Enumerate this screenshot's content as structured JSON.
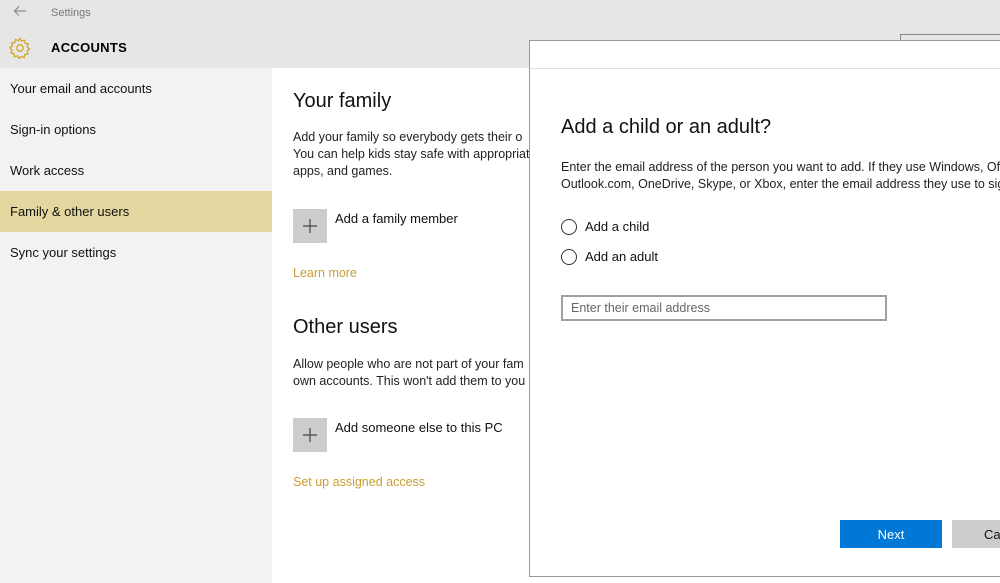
{
  "window": {
    "app_title": "Settings",
    "section_title": "ACCOUNTS",
    "back_icon": "back-arrow-icon",
    "section_icon": "gear-icon",
    "accent_color": "#c7a033"
  },
  "sidebar": {
    "items": [
      {
        "label": "Your email and accounts",
        "selected": false
      },
      {
        "label": "Sign-in options",
        "selected": false
      },
      {
        "label": "Work access",
        "selected": false
      },
      {
        "label": "Family & other users",
        "selected": true
      },
      {
        "label": "Sync your settings",
        "selected": false
      }
    ],
    "selected_color": "#e3d69e"
  },
  "main": {
    "family": {
      "heading": "Your family",
      "description_line1": "Add your family so everybody gets their o",
      "description_line2": "You can help kids stay safe with appropriat",
      "description_line3": "apps, and games.",
      "add_label": "Add a family member",
      "learn_more": "Learn more"
    },
    "other_users": {
      "heading": "Other users",
      "description_line1": "Allow people who are not part of your fam",
      "description_line2": "own accounts. This won't add them to you",
      "add_label": "Add someone else to this PC",
      "assigned_access": "Set up assigned access"
    }
  },
  "dialog": {
    "title": "Add a child or an adult?",
    "description_line1": "Enter the email address of the person you want to add. If they use Windows, Of",
    "description_line2": "Outlook.com, OneDrive, Skype, or Xbox, enter the email address they use to sig",
    "options": [
      {
        "label": "Add a child",
        "selected": false
      },
      {
        "label": "Add an adult",
        "selected": false
      }
    ],
    "email_placeholder": "Enter their email address",
    "email_value": "",
    "next_label": "Next",
    "cancel_label": "Ca",
    "primary_color": "#0078d7"
  }
}
